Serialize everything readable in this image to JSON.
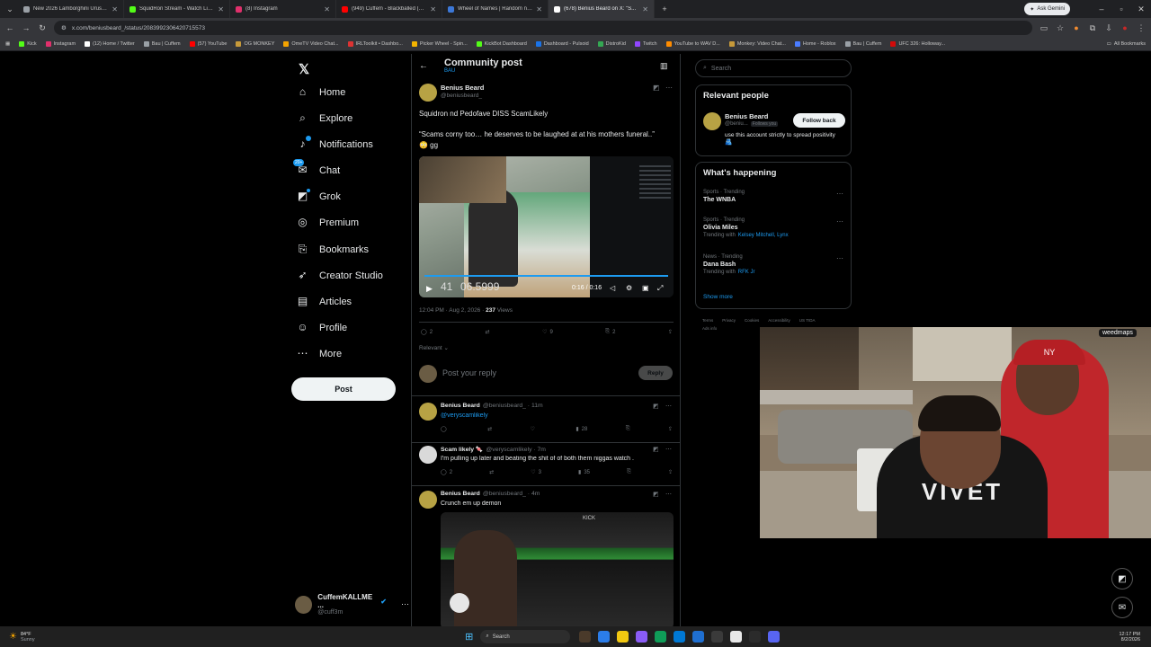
{
  "browser": {
    "tabs": [
      {
        "title": "New 2026 Lamborghini Urus SE",
        "color": "#9aa0a6"
      },
      {
        "title": "SquidRon Stream - Watch Live -",
        "color": "#53fc18"
      },
      {
        "title": "(8) Instagram",
        "color": "#e1306c"
      },
      {
        "title": "(949) Cuffem - Blackballed (Si...",
        "color": "#ff0000"
      },
      {
        "title": "Wheel of Names | Random nam...",
        "color": "#3c78d8"
      },
      {
        "title": "(678) Benius Beard on X: \"S...",
        "color": "#ffffff"
      }
    ],
    "ask_gemini": "Ask Gemini",
    "url": "x.com/beniusbeard_/status/2083992306420715573",
    "bookmarks": [
      {
        "label": "Kick",
        "color": "#53fc18"
      },
      {
        "label": "Instagram",
        "color": "#e1306c"
      },
      {
        "label": "(12) Home / Twitter",
        "color": "#ffffff"
      },
      {
        "label": "Bau | Cuffem",
        "color": "#9aa0a6"
      },
      {
        "label": "(57) YouTube",
        "color": "#ff0000"
      },
      {
        "label": "OG MONKEY",
        "color": "#c79a3a"
      },
      {
        "label": "OmeTV Video Chat...",
        "color": "#f4a300"
      },
      {
        "label": "IRLToolkit • Dashbo...",
        "color": "#d33"
      },
      {
        "label": "Picker Wheel - Spin...",
        "color": "#f4b400"
      },
      {
        "label": "KickBot Dashboard",
        "color": "#53fc18"
      },
      {
        "label": "Dashboard - Pulsoid",
        "color": "#1a73e8"
      },
      {
        "label": "DistroKid",
        "color": "#34a853"
      },
      {
        "label": "Twitch",
        "color": "#9146ff"
      },
      {
        "label": "YouTube to WAV D...",
        "color": "#ff8c00"
      },
      {
        "label": "Monkey: Video Chat...",
        "color": "#c79a3a"
      },
      {
        "label": "Home - Roblox",
        "color": "#4a7cff"
      },
      {
        "label": "Bau | Cuffem",
        "color": "#9aa0a6"
      },
      {
        "label": "UFC 326: Holloway...",
        "color": "#d20a0a"
      }
    ],
    "all_bookmarks": "All Bookmarks"
  },
  "nav": {
    "items": [
      {
        "label": "Home",
        "icon": "home-icon",
        "glyph": "⌂"
      },
      {
        "label": "Explore",
        "icon": "search-icon",
        "glyph": "⌕"
      },
      {
        "label": "Notifications",
        "icon": "bell-icon",
        "glyph": "♪"
      },
      {
        "label": "Chat",
        "icon": "chat-icon",
        "glyph": "✉"
      },
      {
        "label": "Grok",
        "icon": "grok-icon",
        "glyph": "◩"
      },
      {
        "label": "Premium",
        "icon": "premium-icon",
        "glyph": "◎"
      },
      {
        "label": "Bookmarks",
        "icon": "bookmark-icon",
        "glyph": "⎘"
      },
      {
        "label": "Creator Studio",
        "icon": "rocket-icon",
        "glyph": "➶"
      },
      {
        "label": "Articles",
        "icon": "article-icon",
        "glyph": "▤"
      },
      {
        "label": "Profile",
        "icon": "profile-icon",
        "glyph": "☺"
      },
      {
        "label": "More",
        "icon": "more-icon",
        "glyph": "⋯"
      }
    ],
    "notif_badge": "",
    "chat_badge": "20+",
    "post_label": "Post",
    "account_name": "CuffemKALLME ...",
    "account_handle": "@cuff3m"
  },
  "post": {
    "header_title": "Community post",
    "header_sub": "BAU",
    "author_name": "Benius Beard",
    "author_handle": "@beniusbeard_",
    "text1": "Squidron nd Pedofave DISS ScamLikely",
    "text2": "“Scams corny too… he deserves to be laughed at at his mothers funeral..”",
    "text3": "😳 gg",
    "video_overlay_a": "41",
    "video_overlay_b": "06.5999",
    "video_time": "0:16 / 0:16",
    "video_progress": 1.0,
    "timestamp": "12:04 PM · Aug 2, 2026 ·",
    "views_count": "237",
    "views_label": "Views",
    "replies": "2",
    "likes": "9",
    "bookmarks": "2",
    "sort_label": "Relevant",
    "reply_placeholder": "Post your reply",
    "reply_button": "Reply"
  },
  "replies": [
    {
      "name": "Benius Beard",
      "meta": "@beniusbeard_ · 11m",
      "text": "@veryscamlikely",
      "stat_views": "28",
      "stat_replies": "",
      "stat_likes": ""
    },
    {
      "name": "Scam likely 🍬",
      "meta": "@veryscamlikely · 7m",
      "text": "I'm pulling up later and beating the shit of of both them niggas watch .",
      "stat_views": "35",
      "stat_replies": "2",
      "stat_likes": "3"
    },
    {
      "name": "Benius Beard",
      "meta": "@beniusbeard_ · 4m",
      "text": "Crunch em up demon",
      "stat_views": "",
      "stat_replies": "",
      "stat_likes": ""
    }
  ],
  "right": {
    "search_placeholder": "Search",
    "relevant_title": "Relevant people",
    "person_name": "Benius Beard",
    "person_handle": "@beniu...",
    "follows_you": "Follows you",
    "follow_back": "Follow back",
    "person_bio": "use this account strictly to spread positivity 🫂",
    "happening_title": "What's happening",
    "trends": [
      {
        "cat": "Sports · Trending",
        "name": "The WNBA",
        "with": "",
        "with_names": ""
      },
      {
        "cat": "Sports · Trending",
        "name": "Olivia Miles",
        "with": "Trending with",
        "with_names": "Kelsey Mitchell, Lynx"
      },
      {
        "cat": "News · Trending",
        "name": "Dana Bash",
        "with": "Trending with",
        "with_names": "RFK Jr"
      }
    ],
    "show_more": "Show more",
    "footer": [
      "Terms",
      "Privacy",
      "Cookies",
      "Accessibility",
      "US TIDA",
      "Ads info"
    ]
  },
  "cam": {
    "logo": "weedmaps",
    "shirt_text": "VIVET",
    "cap_text": "NY",
    "kick": "KICK"
  },
  "taskbar": {
    "weather_temp": "84°F",
    "weather_desc": "Sunny",
    "search": "Search",
    "time": "12:17 PM",
    "date": "8/2/2026"
  }
}
